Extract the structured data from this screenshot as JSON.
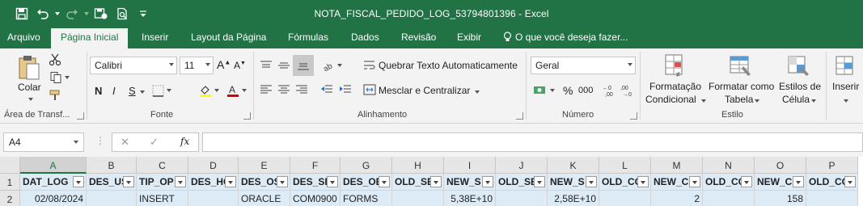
{
  "window": {
    "title": "NOTA_FISCAL_PEDIDO_LOG_53794801396 - Excel"
  },
  "qat": {
    "icons": [
      "save-icon",
      "undo-icon",
      "redo-icon",
      "save-cloud-icon",
      "print-preview-icon",
      "customize-icon"
    ]
  },
  "tabs": {
    "arquivo": "Arquivo",
    "pagina_inicial": "Página Inicial",
    "inserir": "Inserir",
    "layout": "Layout da Página",
    "formulas": "Fórmulas",
    "dados": "Dados",
    "revisao": "Revisão",
    "exibir": "Exibir",
    "tell_me": "O que você deseja fazer..."
  },
  "ribbon": {
    "clipboard": {
      "paste": "Colar",
      "label": "Área de Transf..."
    },
    "font": {
      "name": "Calibri",
      "size": "11",
      "bold": "N",
      "italic": "I",
      "underline": "S",
      "label": "Fonte"
    },
    "alignment": {
      "wrap": "Quebrar Texto Automaticamente",
      "merge": "Mesclar e Centralizar",
      "label": "Alinhamento"
    },
    "number": {
      "format": "Geral",
      "percent": "%",
      "thousands": "000",
      "label": "Número"
    },
    "styles": {
      "cond_1": "Formatação",
      "cond_2": "Condicional",
      "table_1": "Formatar como",
      "table_2": "Tabela",
      "cell_1": "Estilos de",
      "cell_2": "Célula",
      "label": "Estilo"
    },
    "cells": {
      "insert": "Inserir"
    }
  },
  "formula_bar": {
    "name_box": "A4",
    "fx": "fx",
    "value": ""
  },
  "sheet": {
    "columns": [
      "A",
      "B",
      "C",
      "D",
      "E",
      "F",
      "G",
      "H",
      "I",
      "J",
      "K",
      "L",
      "M",
      "N",
      "O",
      "P"
    ],
    "rows": [
      "1",
      "2"
    ],
    "header_row": [
      "DAT_LOG",
      "DES_US",
      "TIP_OP",
      "DES_HC",
      "DES_OS",
      "DES_SI",
      "DES_OE",
      "OLD_SE",
      "NEW_S",
      "OLD_SE",
      "NEW_S",
      "OLD_CC",
      "NEW_C",
      "OLD_CC",
      "NEW_C",
      "OLD_CC"
    ],
    "data_row": [
      "02/08/2024",
      "",
      "INSERT",
      "",
      "ORACLE",
      "COM0900",
      "FORMS",
      "",
      "5,38E+10",
      "",
      "2,58E+10",
      "",
      "2",
      "",
      "158",
      ""
    ],
    "selected_cell": "A4",
    "header_fill": "#ddebf7",
    "accent": "#217346"
  }
}
